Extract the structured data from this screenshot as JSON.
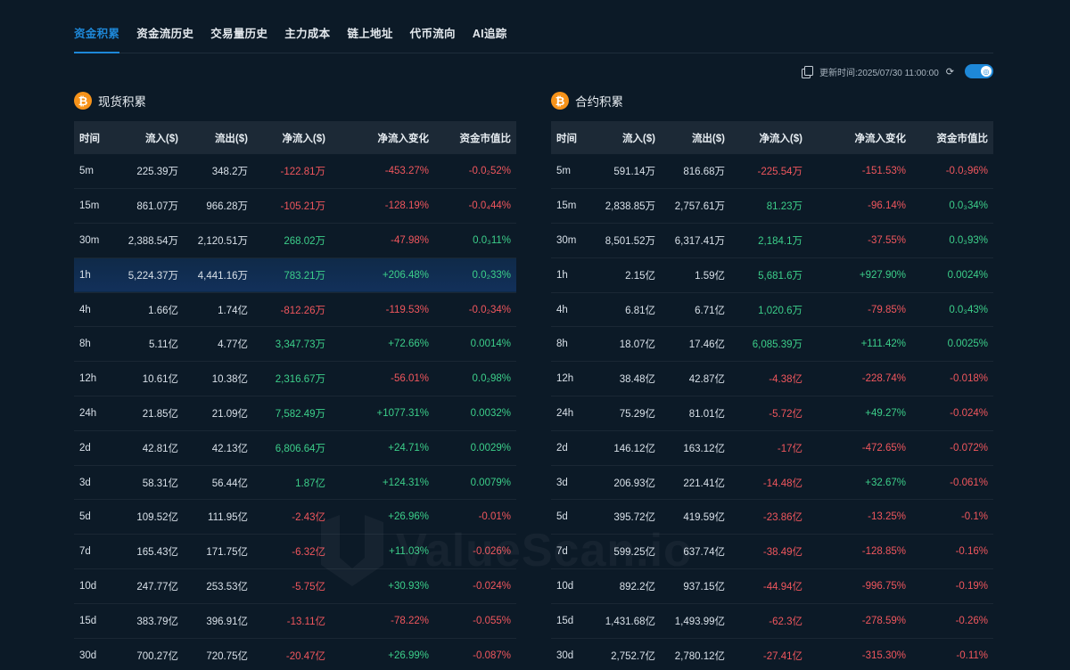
{
  "tabs": [
    "资金积累",
    "资金流历史",
    "交易量历史",
    "主力成本",
    "链上地址",
    "代币流向",
    "AI追踪"
  ],
  "active_tab": 0,
  "update_time": "更新时间:2025/07/30 11:00:00",
  "watermark": "ValueScan.io",
  "icons": {
    "copy": "copy-icon",
    "refresh": "refresh-icon",
    "toggle": "toggle-switch",
    "coin": "bitcoin-icon"
  },
  "colors": {
    "accent": "#1e88d8",
    "positive": "#3ccf8a",
    "negative": "#f0565d",
    "bitcoin": "#f7931a"
  },
  "spot": {
    "title": "现货积累",
    "headers": [
      "时间",
      "流入($)",
      "流出($)",
      "净流入($)",
      "净流入变化",
      "资金市值比"
    ],
    "rows": [
      [
        "5m",
        "225.39万",
        "348.2万",
        "-122.81万",
        "-453.27%",
        "-0.0₂52%"
      ],
      [
        "15m",
        "861.07万",
        "966.28万",
        "-105.21万",
        "-128.19%",
        "-0.0₄44%"
      ],
      [
        "30m",
        "2,388.54万",
        "2,120.51万",
        "268.02万",
        "-47.98%",
        "0.0₃11%"
      ],
      [
        "1h",
        "5,224.37万",
        "4,441.16万",
        "783.21万",
        "+206.48%",
        "0.0₂33%"
      ],
      [
        "4h",
        "1.66亿",
        "1.74亿",
        "-812.26万",
        "-119.53%",
        "-0.0₂34%"
      ],
      [
        "8h",
        "5.11亿",
        "4.77亿",
        "3,347.73万",
        "+72.66%",
        "0.0014%"
      ],
      [
        "12h",
        "10.61亿",
        "10.38亿",
        "2,316.67万",
        "-56.01%",
        "0.0₂98%"
      ],
      [
        "24h",
        "21.85亿",
        "21.09亿",
        "7,582.49万",
        "+1077.31%",
        "0.0032%"
      ],
      [
        "2d",
        "42.81亿",
        "42.13亿",
        "6,806.64万",
        "+24.71%",
        "0.0029%"
      ],
      [
        "3d",
        "58.31亿",
        "56.44亿",
        "1.87亿",
        "+124.31%",
        "0.0079%"
      ],
      [
        "5d",
        "109.52亿",
        "111.95亿",
        "-2.43亿",
        "+26.96%",
        "-0.01%"
      ],
      [
        "7d",
        "165.43亿",
        "171.75亿",
        "-6.32亿",
        "+11.03%",
        "-0.026%"
      ],
      [
        "10d",
        "247.77亿",
        "253.53亿",
        "-5.75亿",
        "+30.93%",
        "-0.024%"
      ],
      [
        "15d",
        "383.79亿",
        "396.91亿",
        "-13.11亿",
        "-78.22%",
        "-0.055%"
      ],
      [
        "30d",
        "700.27亿",
        "720.75亿",
        "-20.47亿",
        "+26.99%",
        "-0.087%"
      ]
    ],
    "highlight_row": 3
  },
  "futures": {
    "title": "合约积累",
    "headers": [
      "时间",
      "流入($)",
      "流出($)",
      "净流入($)",
      "净流入变化",
      "资金市值比"
    ],
    "rows": [
      [
        "5m",
        "591.14万",
        "816.68万",
        "-225.54万",
        "-151.53%",
        "-0.0₂96%"
      ],
      [
        "15m",
        "2,838.85万",
        "2,757.61万",
        "81.23万",
        "-96.14%",
        "0.0₃34%"
      ],
      [
        "30m",
        "8,501.52万",
        "6,317.41万",
        "2,184.1万",
        "-37.55%",
        "0.0₃93%"
      ],
      [
        "1h",
        "2.15亿",
        "1.59亿",
        "5,681.6万",
        "+927.90%",
        "0.0024%"
      ],
      [
        "4h",
        "6.81亿",
        "6.71亿",
        "1,020.6万",
        "-79.85%",
        "0.0₃43%"
      ],
      [
        "8h",
        "18.07亿",
        "17.46亿",
        "6,085.39万",
        "+111.42%",
        "0.0025%"
      ],
      [
        "12h",
        "38.48亿",
        "42.87亿",
        "-4.38亿",
        "-228.74%",
        "-0.018%"
      ],
      [
        "24h",
        "75.29亿",
        "81.01亿",
        "-5.72亿",
        "+49.27%",
        "-0.024%"
      ],
      [
        "2d",
        "146.12亿",
        "163.12亿",
        "-17亿",
        "-472.65%",
        "-0.072%"
      ],
      [
        "3d",
        "206.93亿",
        "221.41亿",
        "-14.48亿",
        "+32.67%",
        "-0.061%"
      ],
      [
        "5d",
        "395.72亿",
        "419.59亿",
        "-23.86亿",
        "-13.25%",
        "-0.1%"
      ],
      [
        "7d",
        "599.25亿",
        "637.74亿",
        "-38.49亿",
        "-128.85%",
        "-0.16%"
      ],
      [
        "10d",
        "892.2亿",
        "937.15亿",
        "-44.94亿",
        "-996.75%",
        "-0.19%"
      ],
      [
        "15d",
        "1,431.68亿",
        "1,493.99亿",
        "-62.3亿",
        "-278.59%",
        "-0.26%"
      ],
      [
        "30d",
        "2,752.7亿",
        "2,780.12亿",
        "-27.41亿",
        "-315.30%",
        "-0.11%"
      ]
    ],
    "highlight_row": -1
  }
}
